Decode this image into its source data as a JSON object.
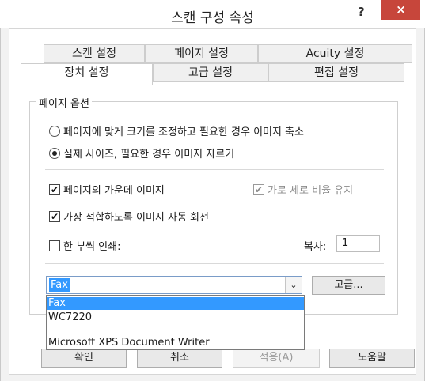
{
  "window": {
    "title": "스캔 구성 속성",
    "help_label": "?",
    "close_label": "×"
  },
  "tabs": {
    "row1": [
      "스캔 설정",
      "페이지 설정",
      "Acuity 설정"
    ],
    "row2": [
      "장치 설정",
      "고급 설정",
      "편집 설정"
    ],
    "active": "장치 설정"
  },
  "group": {
    "label": "페이지 옵션",
    "radio_fit": "페이지에 맞게 크기를 조정하고 필요한 경우 이미지 축소",
    "radio_actual": "실제 사이즈, 필요한 경우 이미지 자르기",
    "selected_radio": "radio_actual",
    "center_image": "페이지의 가운데 이미지",
    "keep_ratio": "가로 세로 비율 유지",
    "auto_rotate": "가장 적합하도록 이미지 자동 회전",
    "one_up": "한 부씩 인쇄:",
    "copies_label": "복사:",
    "copies_value": "1"
  },
  "printer": {
    "selected": "Fax",
    "options": [
      "Fax",
      "WC7220",
      "Microsoft XPS Document Writer"
    ],
    "advanced_label": "고급..."
  },
  "buttons": {
    "ok": "확인",
    "cancel": "취소",
    "apply": "적용(A)",
    "help": "도움말"
  },
  "check_glyph": "✔",
  "combo_arrow": "⌄"
}
